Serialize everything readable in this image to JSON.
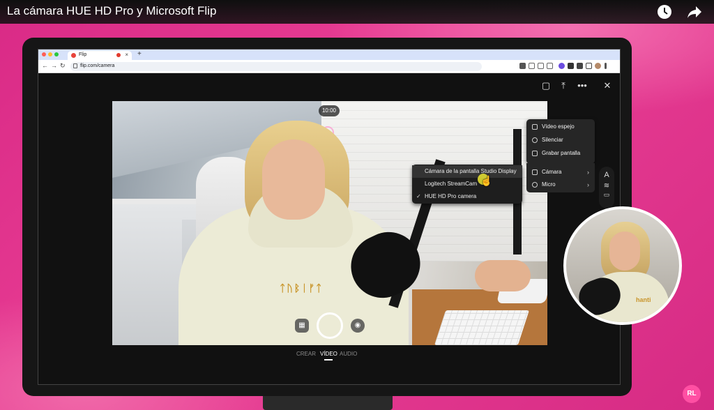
{
  "youtube": {
    "title": "La cámara HUE HD Pro y Microsoft Flip",
    "watch_later_icon": "clock-icon",
    "share_icon": "share-arrow-icon"
  },
  "browser": {
    "tab_title": "Flip",
    "tab_close": "×",
    "new_tab": "+",
    "url": "flip.com/camera"
  },
  "flip": {
    "timer": "10:00",
    "modes": [
      "CREAR",
      "VÍDEO",
      "AUDIO"
    ],
    "active_mode": "VÍDEO",
    "menu": {
      "items": [
        {
          "label": "Vídeo espejo",
          "icon": "mirror-icon"
        },
        {
          "label": "Silenciar",
          "icon": "mic-icon"
        },
        {
          "label": "Grabar pantalla",
          "icon": "screen-record-icon"
        },
        {
          "label": "Cámara",
          "icon": "camera-icon"
        },
        {
          "label": "Micro",
          "icon": "mic-icon"
        }
      ]
    },
    "camera_submenu": [
      {
        "label": "Cámara de la pantalla Studio Display",
        "selected": false
      },
      {
        "label": "Logitech StreamCam",
        "selected": false
      },
      {
        "label": "HUE HD Pro camera",
        "selected": true
      }
    ],
    "tool_pill": {
      "text_tool": "A"
    }
  },
  "pip_print": "hanti",
  "feed_print": "ᛏᚢᛒᛁᚠᛏ",
  "logo": "RL",
  "colors": {
    "background_pink": "#e6338f",
    "accent_yellow": "#ebe632",
    "menu_bg": "#262626"
  }
}
